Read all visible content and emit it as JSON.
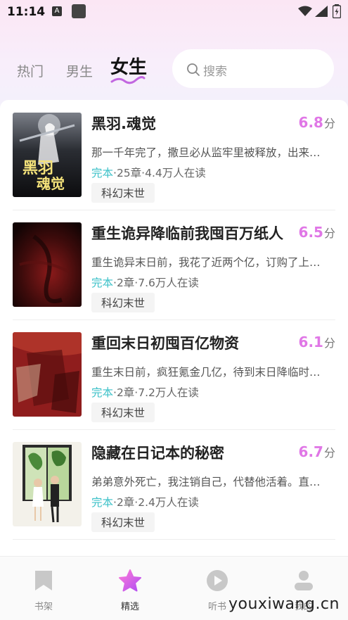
{
  "status": {
    "time": "11:14",
    "a_glyph": "A"
  },
  "tabs": [
    {
      "label": "热门",
      "active": false
    },
    {
      "label": "男生",
      "active": false
    },
    {
      "label": "女生",
      "active": true
    }
  ],
  "search": {
    "placeholder": "搜索"
  },
  "books": [
    {
      "title": "黑羽.魂觉",
      "score": "6.8",
      "score_unit": "分",
      "desc": "那一千年完了，撒旦必从监牢里被释放，出来…",
      "status": "完本",
      "meta": "·25章·4.4万人在读",
      "tag": "科幻末世",
      "cover_text": "黑羽·魂觉"
    },
    {
      "title": "重生诡异降临前我囤百万纸人",
      "score": "6.5",
      "score_unit": "分",
      "desc": "重生诡异末日前，我花了近两个亿，订购了上…",
      "status": "完本",
      "meta": "·2章·7.6万人在读",
      "tag": "科幻末世"
    },
    {
      "title": "重回末日初囤百亿物资",
      "score": "6.1",
      "score_unit": "分",
      "desc": "重生末日前，疯狂氪金几亿，待到末日降临时…",
      "status": "完本",
      "meta": "·2章·7.2万人在读",
      "tag": "科幻末世"
    },
    {
      "title": "隐藏在日记本的秘密",
      "score": "6.7",
      "score_unit": "分",
      "desc": "弟弟意外死亡，我注销自己，代替他活着。直…",
      "status": "完本",
      "meta": "·2章·2.4万人在读",
      "tag": "科幻末世"
    }
  ],
  "nav": [
    {
      "label": "书架",
      "icon": "bookmark-icon",
      "active": false
    },
    {
      "label": "精选",
      "icon": "star-icon",
      "active": true
    },
    {
      "label": "听书",
      "icon": "play-icon",
      "active": false
    },
    {
      "label": "我的",
      "icon": "person-icon",
      "active": false
    }
  ],
  "watermark": "youxiwang.cn",
  "colors": {
    "accent": "#e077e6",
    "status_done": "#3cc1c8",
    "star": "#f060d8"
  }
}
